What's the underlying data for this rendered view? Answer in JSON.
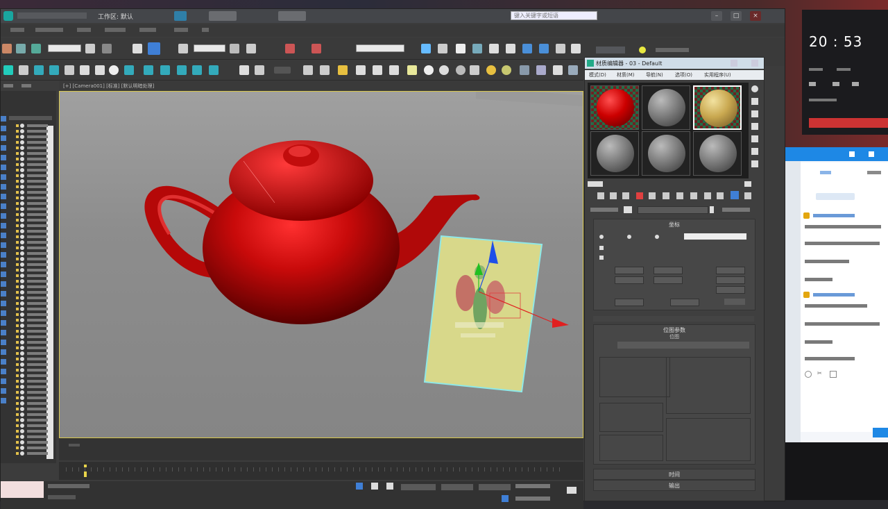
{
  "max": {
    "window_title": "工作区: 默认",
    "search_placeholder": "键入关键字或短语"
  },
  "viewport": {
    "label": "[+] [Camera001] [标准] [默认明暗处理]"
  },
  "material_editor": {
    "title": "材质编辑器 - 03 - Default",
    "menu": [
      "模式(D)",
      "材质(M)",
      "导航(N)",
      "选项(O)",
      "实用程序(U)"
    ],
    "rollout_coords": "坐标",
    "rollout_bitmap": "位图参数",
    "rollout_bitmap_sub": "位图",
    "rollout_time": "时间",
    "rollout_output": "输出"
  },
  "desktop": {
    "clock": "20 : 53"
  },
  "colors": {
    "viewport_bg": "#8c8c8c",
    "teapot_red": "#b50808",
    "plane_yellow": "#d8d88a",
    "selection_border": "#d9c84e",
    "chat_blue": "#1e88e5"
  }
}
